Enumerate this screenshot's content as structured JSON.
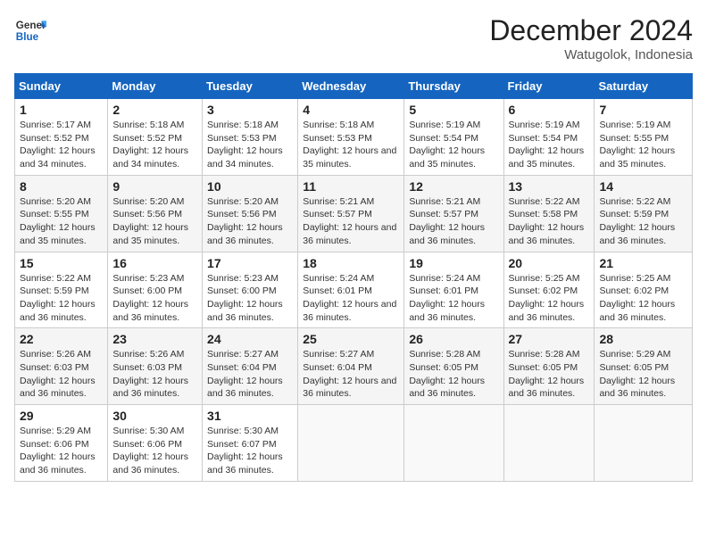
{
  "logo": {
    "text_line1": "General",
    "text_line2": "Blue"
  },
  "header": {
    "month": "December 2024",
    "location": "Watugolok, Indonesia"
  },
  "weekdays": [
    "Sunday",
    "Monday",
    "Tuesday",
    "Wednesday",
    "Thursday",
    "Friday",
    "Saturday"
  ],
  "weeks": [
    [
      {
        "day": "1",
        "sunrise": "5:17 AM",
        "sunset": "5:52 PM",
        "daylight": "12 hours and 34 minutes."
      },
      {
        "day": "2",
        "sunrise": "5:18 AM",
        "sunset": "5:52 PM",
        "daylight": "12 hours and 34 minutes."
      },
      {
        "day": "3",
        "sunrise": "5:18 AM",
        "sunset": "5:53 PM",
        "daylight": "12 hours and 34 minutes."
      },
      {
        "day": "4",
        "sunrise": "5:18 AM",
        "sunset": "5:53 PM",
        "daylight": "12 hours and 35 minutes."
      },
      {
        "day": "5",
        "sunrise": "5:19 AM",
        "sunset": "5:54 PM",
        "daylight": "12 hours and 35 minutes."
      },
      {
        "day": "6",
        "sunrise": "5:19 AM",
        "sunset": "5:54 PM",
        "daylight": "12 hours and 35 minutes."
      },
      {
        "day": "7",
        "sunrise": "5:19 AM",
        "sunset": "5:55 PM",
        "daylight": "12 hours and 35 minutes."
      }
    ],
    [
      {
        "day": "8",
        "sunrise": "5:20 AM",
        "sunset": "5:55 PM",
        "daylight": "12 hours and 35 minutes."
      },
      {
        "day": "9",
        "sunrise": "5:20 AM",
        "sunset": "5:56 PM",
        "daylight": "12 hours and 35 minutes."
      },
      {
        "day": "10",
        "sunrise": "5:20 AM",
        "sunset": "5:56 PM",
        "daylight": "12 hours and 36 minutes."
      },
      {
        "day": "11",
        "sunrise": "5:21 AM",
        "sunset": "5:57 PM",
        "daylight": "12 hours and 36 minutes."
      },
      {
        "day": "12",
        "sunrise": "5:21 AM",
        "sunset": "5:57 PM",
        "daylight": "12 hours and 36 minutes."
      },
      {
        "day": "13",
        "sunrise": "5:22 AM",
        "sunset": "5:58 PM",
        "daylight": "12 hours and 36 minutes."
      },
      {
        "day": "14",
        "sunrise": "5:22 AM",
        "sunset": "5:59 PM",
        "daylight": "12 hours and 36 minutes."
      }
    ],
    [
      {
        "day": "15",
        "sunrise": "5:22 AM",
        "sunset": "5:59 PM",
        "daylight": "12 hours and 36 minutes."
      },
      {
        "day": "16",
        "sunrise": "5:23 AM",
        "sunset": "6:00 PM",
        "daylight": "12 hours and 36 minutes."
      },
      {
        "day": "17",
        "sunrise": "5:23 AM",
        "sunset": "6:00 PM",
        "daylight": "12 hours and 36 minutes."
      },
      {
        "day": "18",
        "sunrise": "5:24 AM",
        "sunset": "6:01 PM",
        "daylight": "12 hours and 36 minutes."
      },
      {
        "day": "19",
        "sunrise": "5:24 AM",
        "sunset": "6:01 PM",
        "daylight": "12 hours and 36 minutes."
      },
      {
        "day": "20",
        "sunrise": "5:25 AM",
        "sunset": "6:02 PM",
        "daylight": "12 hours and 36 minutes."
      },
      {
        "day": "21",
        "sunrise": "5:25 AM",
        "sunset": "6:02 PM",
        "daylight": "12 hours and 36 minutes."
      }
    ],
    [
      {
        "day": "22",
        "sunrise": "5:26 AM",
        "sunset": "6:03 PM",
        "daylight": "12 hours and 36 minutes."
      },
      {
        "day": "23",
        "sunrise": "5:26 AM",
        "sunset": "6:03 PM",
        "daylight": "12 hours and 36 minutes."
      },
      {
        "day": "24",
        "sunrise": "5:27 AM",
        "sunset": "6:04 PM",
        "daylight": "12 hours and 36 minutes."
      },
      {
        "day": "25",
        "sunrise": "5:27 AM",
        "sunset": "6:04 PM",
        "daylight": "12 hours and 36 minutes."
      },
      {
        "day": "26",
        "sunrise": "5:28 AM",
        "sunset": "6:05 PM",
        "daylight": "12 hours and 36 minutes."
      },
      {
        "day": "27",
        "sunrise": "5:28 AM",
        "sunset": "6:05 PM",
        "daylight": "12 hours and 36 minutes."
      },
      {
        "day": "28",
        "sunrise": "5:29 AM",
        "sunset": "6:05 PM",
        "daylight": "12 hours and 36 minutes."
      }
    ],
    [
      {
        "day": "29",
        "sunrise": "5:29 AM",
        "sunset": "6:06 PM",
        "daylight": "12 hours and 36 minutes."
      },
      {
        "day": "30",
        "sunrise": "5:30 AM",
        "sunset": "6:06 PM",
        "daylight": "12 hours and 36 minutes."
      },
      {
        "day": "31",
        "sunrise": "5:30 AM",
        "sunset": "6:07 PM",
        "daylight": "12 hours and 36 minutes."
      },
      null,
      null,
      null,
      null
    ]
  ],
  "labels": {
    "sunrise_prefix": "Sunrise: ",
    "sunset_prefix": "Sunset: ",
    "daylight_prefix": "Daylight: "
  }
}
